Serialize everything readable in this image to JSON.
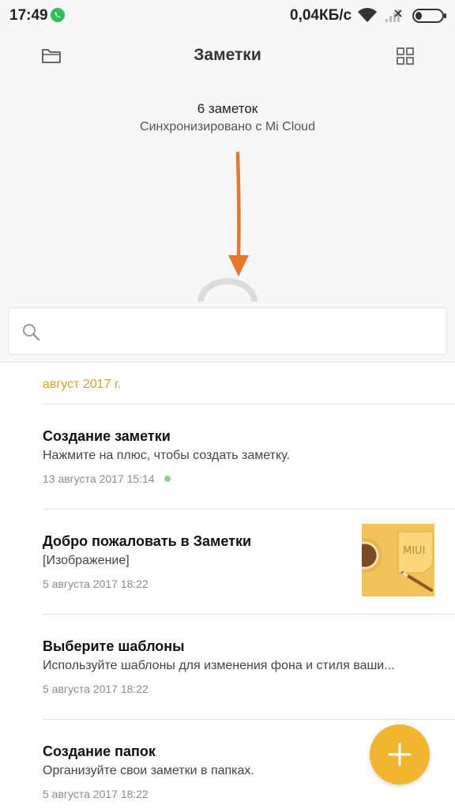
{
  "status_bar": {
    "time": "17:49",
    "speed": "0,04КБ/с",
    "icons": [
      "whatsapp-icon",
      "wifi-icon",
      "signal-icon",
      "battery-icon"
    ]
  },
  "header": {
    "title": "Заметки",
    "left_icon": "folder-icon",
    "right_icon": "grid-view-icon"
  },
  "summary": {
    "count": "6 заметок",
    "sync": "Синхронизировано с Mi Cloud"
  },
  "search": {
    "placeholder": "",
    "value": ""
  },
  "list": {
    "month": "август 2017 г.",
    "notes": [
      {
        "title": "Создание заметки",
        "body": "Нажмите на плюс, чтобы создать заметку.",
        "date": "13 августа 2017 15:14",
        "synced_dot": true
      },
      {
        "title": "Добро пожаловать в Заметки",
        "body": "[Изображение]",
        "date": "5 августа 2017 18:22",
        "has_thumbnail": true
      },
      {
        "title": "Выберите шаблоны",
        "body": "Используйте шаблоны для изменения фона и стиля ваши...",
        "date": "5 августа 2017 18:22"
      },
      {
        "title": "Создание папок",
        "body": "Организуйте свои заметки в папках.",
        "date": "5 августа 2017 18:22"
      }
    ]
  },
  "fab": {
    "icon": "plus-icon"
  },
  "colors": {
    "accent": "#f2b530",
    "month_label": "#d9a425",
    "arrow": "#e9772a",
    "sync_dot": "#8ccf8a",
    "top_background": "#f7f7f7"
  }
}
